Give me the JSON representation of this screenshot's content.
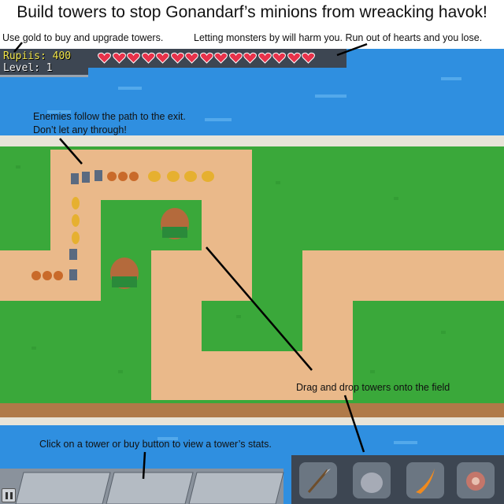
{
  "title": "Build towers to stop Gonandarf’s minions from wreacking havok!",
  "tips": {
    "gold": "Use gold to buy and upgrade towers.",
    "hearts": "Letting monsters by will harm you. Run out of hearts and you lose.",
    "path_line1": "Enemies follow the path to the exit.",
    "path_line2": "Don’t let any through!",
    "drag": "Drag and drop towers onto the field",
    "stats": "Click on a tower or buy button to view a tower’s stats."
  },
  "hud": {
    "gold_label": "Rupiis: 400",
    "level_label": "Level: 1",
    "hearts_count": 15
  },
  "shop": [
    {
      "name": "spear-tower",
      "icon": "spear-icon"
    },
    {
      "name": "rock-tower",
      "icon": "rock-icon"
    },
    {
      "name": "fire-tower",
      "icon": "flame-icon"
    },
    {
      "name": "meat-tower",
      "icon": "meat-icon"
    }
  ],
  "colors": {
    "water": "#2f8fe0",
    "grass": "#3aa83a",
    "path": "#eab98a",
    "heart": "#e8324a",
    "gold_text": "#f0e44a"
  }
}
